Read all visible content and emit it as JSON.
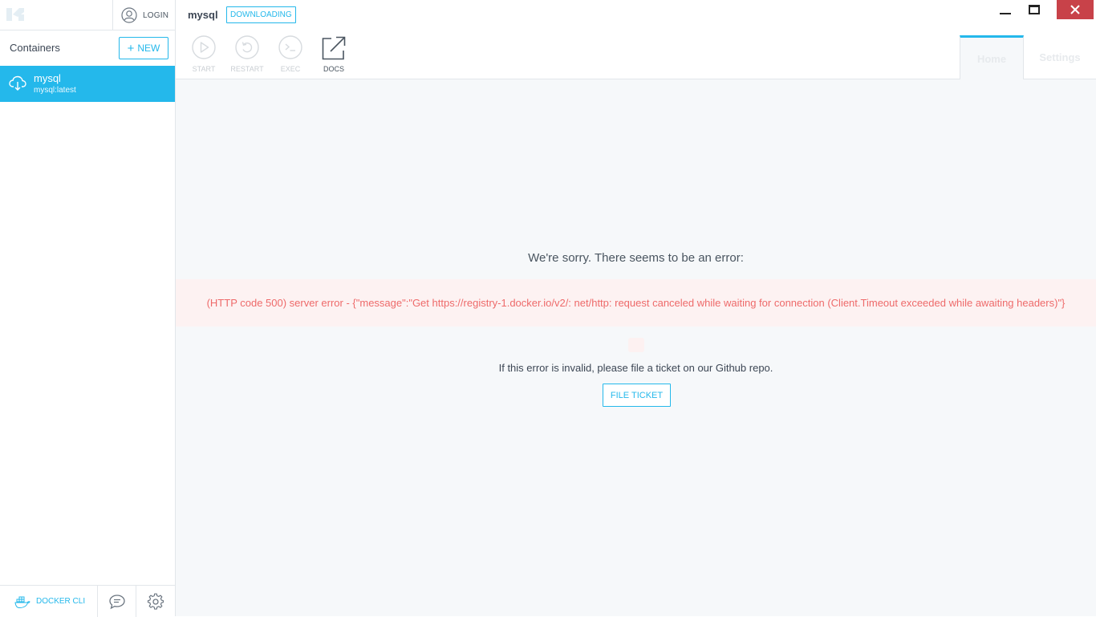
{
  "sidebar": {
    "login_label": "LOGIN",
    "containers_title": "Containers",
    "new_button": {
      "icon": "+",
      "label": "NEW"
    },
    "containers": [
      {
        "name": "mysql",
        "image": "mysql:latest",
        "icon": "cloud-download-icon"
      }
    ],
    "footer": {
      "docker_cli_label": "DOCKER CLI"
    }
  },
  "header": {
    "container_name": "mysql",
    "status_badge": "DOWNLOADING",
    "toolbar": [
      {
        "label": "START",
        "icon": "play-icon",
        "enabled": false
      },
      {
        "label": "RESTART",
        "icon": "restart-icon",
        "enabled": false
      },
      {
        "label": "EXEC",
        "icon": "terminal-icon",
        "enabled": false
      },
      {
        "label": "DOCS",
        "icon": "external-link-icon",
        "enabled": true
      }
    ],
    "tabs": [
      {
        "label": "Home",
        "active": true
      },
      {
        "label": "Settings",
        "active": false
      }
    ]
  },
  "main": {
    "error_title": "We're sorry. There seems to be an error:",
    "error_message": "(HTTP code 500) server error - {\"message\":\"Get https://registry-1.docker.io/v2/: net/http: request canceled while waiting for connection (Client.Timeout exceeded while awaiting headers)\"}",
    "hint": "If this error is invalid, please file a ticket on our Github repo.",
    "file_ticket_label": "FILE TICKET"
  },
  "colors": {
    "accent": "#24b8eb",
    "error_text": "#ee6a6a",
    "error_bg": "#fdf2f2",
    "close_button": "#c84249"
  }
}
